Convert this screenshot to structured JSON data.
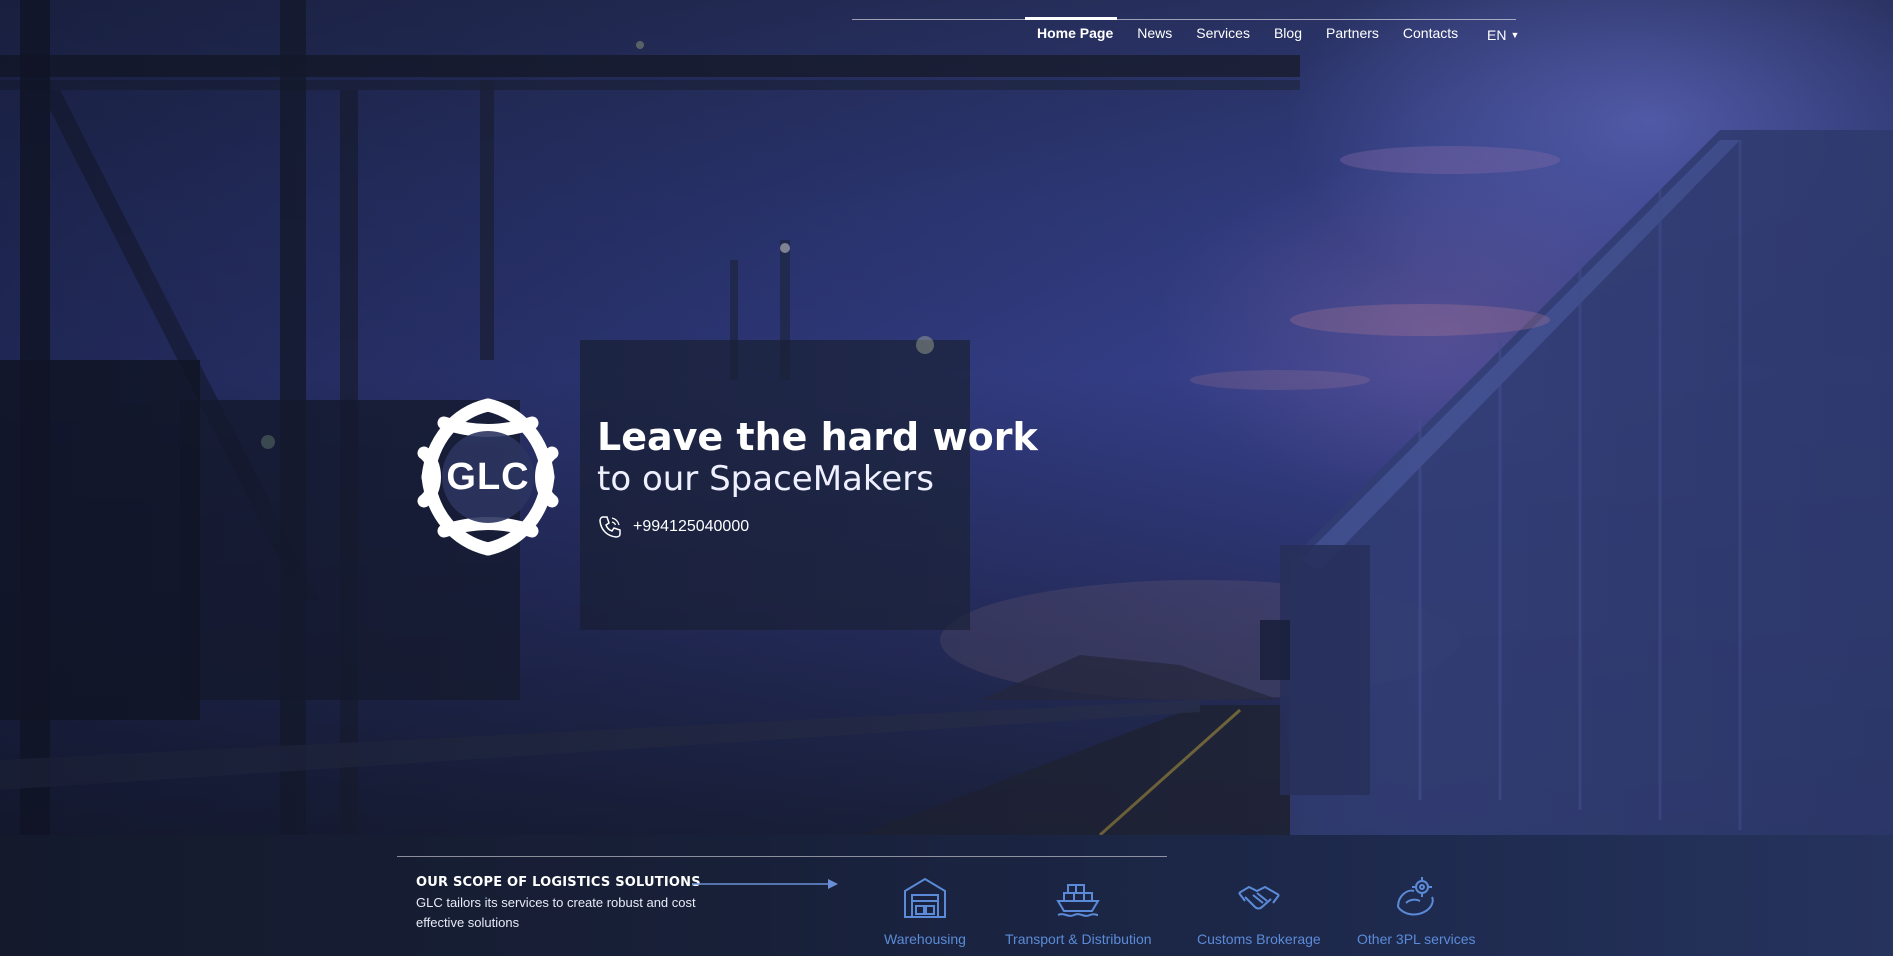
{
  "nav": {
    "items": [
      {
        "label": "Home Page",
        "active": true
      },
      {
        "label": "News"
      },
      {
        "label": "Services"
      },
      {
        "label": "Blog"
      },
      {
        "label": "Partners"
      },
      {
        "label": "Contacts"
      }
    ],
    "language": "EN"
  },
  "hero": {
    "logo_text": "GLC",
    "headline_bold": "Leave the hard work",
    "headline_light": "to our SpaceMakers",
    "phone": "+994125040000"
  },
  "scope": {
    "title": "OUR SCOPE OF LOGISTICS SOLUTIONS",
    "description": "GLC tailors its services to create robust and cost effective solutions"
  },
  "services": [
    {
      "label": "Warehousing",
      "icon": "warehouse-icon"
    },
    {
      "label": "Transport & Distribution",
      "icon": "cargo-ship-icon"
    },
    {
      "label": "Customs Brokerage",
      "icon": "handshake-icon"
    },
    {
      "label": "Other 3PL services",
      "icon": "settings-hand-icon"
    }
  ],
  "colors": {
    "accent": "#5b8bd8",
    "band": "#182039",
    "sky": "#3a4596"
  }
}
